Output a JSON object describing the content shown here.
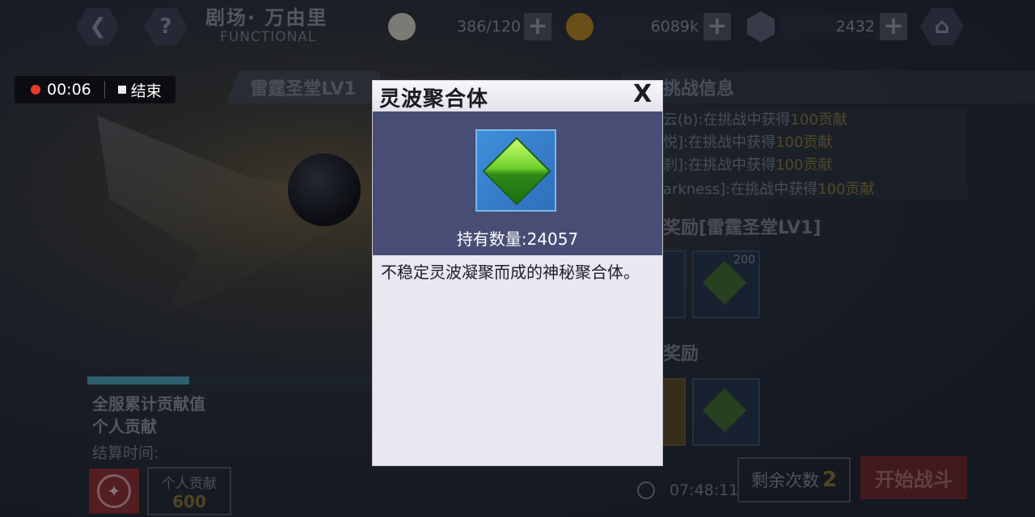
{
  "header": {
    "back_icon": "chevron-left-icon",
    "help_label": "?",
    "title": "剧场· 万由里",
    "subtitle": "FUNCTIONAL",
    "stamina": "386/120",
    "gold": "6089k",
    "crystal": "2432",
    "plus": "+",
    "home_icon": "home-icon"
  },
  "recording": {
    "time": "00:06",
    "stop_label": "结束"
  },
  "left_panel": {
    "stage_tab": "雷霆圣堂LV1",
    "total_label": "全服累计贡献值",
    "personal_label": "个人贡献",
    "settle_label": "结算时间:",
    "contrib_title": "个人贡献",
    "contrib_value": "600"
  },
  "right_panel": {
    "head": "挑战信息",
    "lines": [
      {
        "prefix": "云(b):",
        "text": "在挑战中获得",
        "value": "100贡献"
      },
      {
        "prefix": "悦]:",
        "text": "在挑战中获得",
        "value": "100贡献"
      },
      {
        "prefix": "刹]:",
        "text": "在挑战中获得",
        "value": "100贡献"
      },
      {
        "prefix": "arkness]:",
        "text": "在挑战中获得",
        "value": "100贡献"
      }
    ],
    "reward_section_1": "奖励[雷霆圣堂LV1]",
    "reward_count": "200",
    "reward_section_2": "奖励",
    "remaining_label": "剩余次数",
    "remaining_value": "2",
    "start_button": "开始战斗",
    "timer": "07:48:11"
  },
  "dialog": {
    "title": "灵波聚合体",
    "close": "X",
    "item_icon": "green-crystal-icon",
    "quantity_label": "持有数量:",
    "quantity_value": "24057",
    "description": "不稳定灵波凝聚而成的神秘聚合体。"
  },
  "colors": {
    "dialog_top": "#474d74",
    "dialog_body": "#e9e7ef",
    "item_frame": "#3f8fd9",
    "gem": "#6ed12b",
    "record_dot": "#e8392c"
  }
}
